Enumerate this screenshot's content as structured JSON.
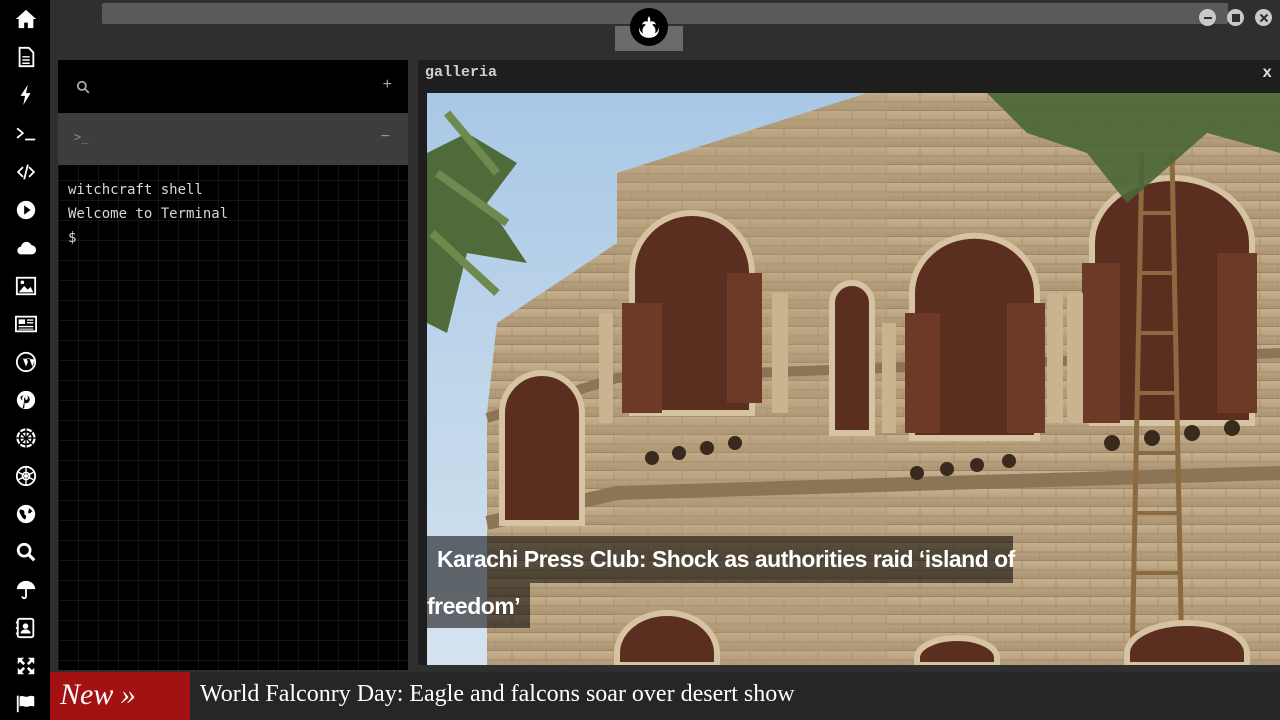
{
  "sidebar": {
    "items": [
      {
        "icon": "home-icon"
      },
      {
        "icon": "document-icon"
      },
      {
        "icon": "lightning-icon"
      },
      {
        "icon": "terminal-icon"
      },
      {
        "icon": "code-icon"
      },
      {
        "icon": "play-icon"
      },
      {
        "icon": "cloud-icon"
      },
      {
        "icon": "image-icon"
      },
      {
        "icon": "newspaper-icon"
      },
      {
        "icon": "wordpress-icon"
      },
      {
        "icon": "pinterest-icon"
      },
      {
        "icon": "galactic-empire-icon"
      },
      {
        "icon": "death-star-icon"
      },
      {
        "icon": "globe-icon"
      },
      {
        "icon": "search-icon"
      },
      {
        "icon": "umbrella-icon"
      },
      {
        "icon": "contact-card-icon"
      },
      {
        "icon": "expand-arrows-icon"
      },
      {
        "icon": "flag-icon"
      }
    ]
  },
  "topbar": {
    "logo": "rebel-alliance-icon",
    "window_controls": [
      "minimize",
      "maximize",
      "close"
    ]
  },
  "terminal": {
    "search_icon": "search-icon",
    "add_label": "+",
    "tab_prompt": ">_",
    "tab_minus": "−",
    "lines": [
      "witchcraft shell",
      "Welcome to Terminal",
      "$"
    ]
  },
  "gallery": {
    "title": "galleria",
    "close_label": "x",
    "caption_line1": "Karachi Press Club: Shock as authorities raid ‘island of",
    "caption_line2": "freedom’"
  },
  "ticker": {
    "badge": "New »",
    "headline": "World Falconry Day: Eagle and falcons soar over desert show"
  }
}
